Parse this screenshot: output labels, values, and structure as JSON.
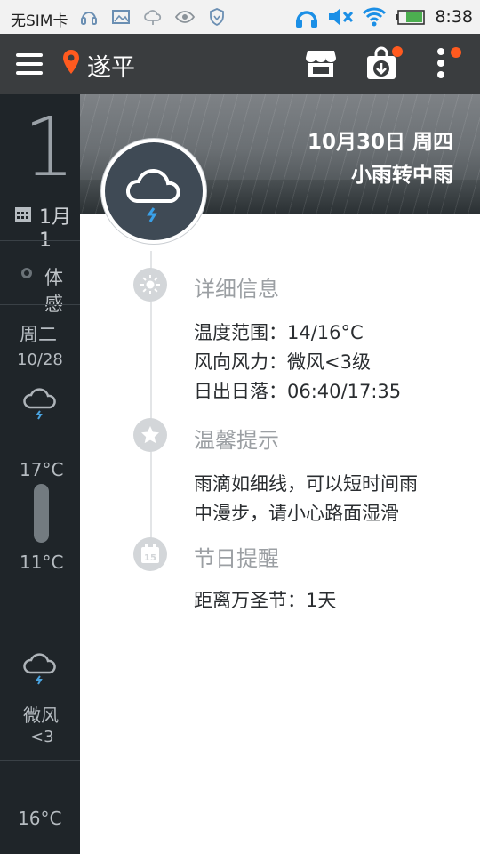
{
  "status_bar": {
    "carrier": "无SIM卡",
    "time": "8:38",
    "battery_color": "#4caf50"
  },
  "app_bar": {
    "city": "遂平",
    "accent_color": "#ff5a1f"
  },
  "background_forecast": {
    "current_temp_partial": "1",
    "date_partial": "1月1",
    "feels_like_partial": "体感",
    "day_label": "周二",
    "day_date": "10/28",
    "high": "17°C",
    "low": "11°C",
    "wind": "微风",
    "wind_level": "<3",
    "next_high": "16°C"
  },
  "detail": {
    "date": "10月30日 周四",
    "condition": "小雨转中雨",
    "sections": [
      {
        "icon": "sun-icon",
        "title": "详细信息",
        "lines": [
          "温度范围：14/16°C",
          "风向风力：微风<3级",
          "日出日落：06:40/17:35"
        ]
      },
      {
        "icon": "star-icon",
        "title": "温馨提示",
        "lines": [
          "雨滴如细线，可以短时间雨",
          "中漫步，请小心路面湿滑"
        ]
      },
      {
        "icon": "calendar-icon",
        "title": "节日提醒",
        "calendar_day": "15",
        "lines": [
          "距离万圣节：1天"
        ]
      }
    ]
  }
}
